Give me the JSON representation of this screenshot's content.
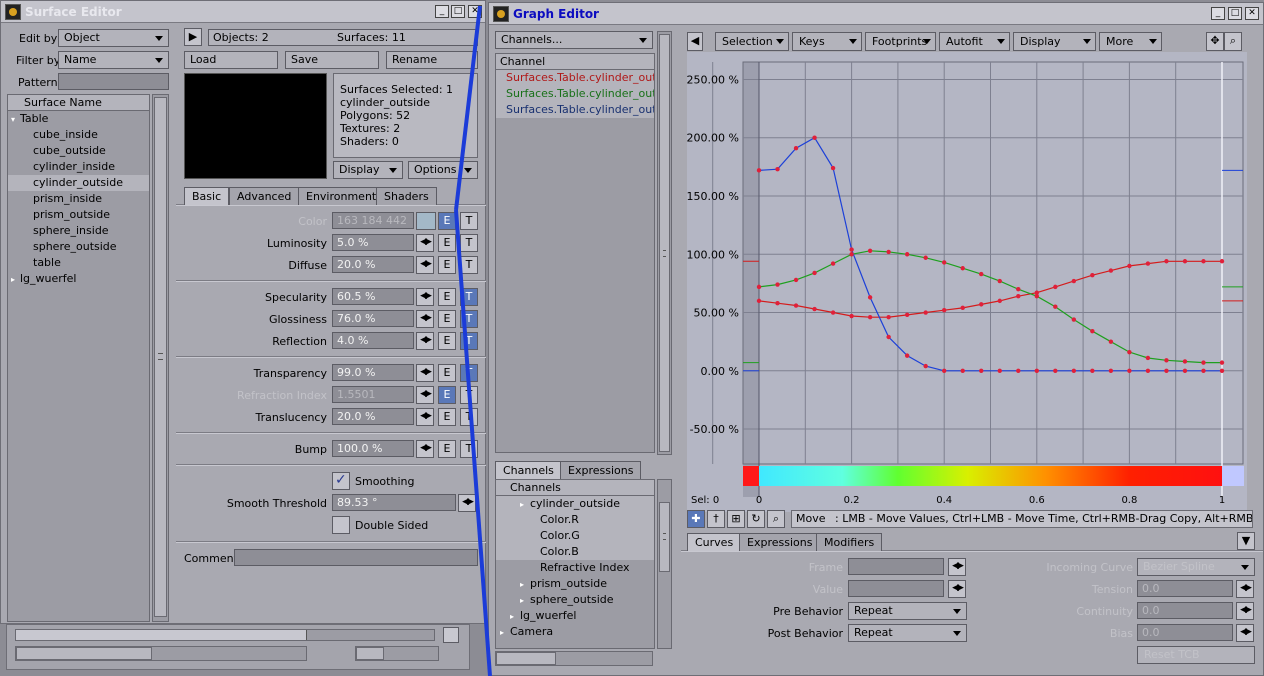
{
  "surface_editor": {
    "title": "Surface Editor",
    "edit_by_label": "Edit by",
    "edit_by_value": "Object",
    "filter_by_label": "Filter by",
    "filter_by_value": "Name",
    "pattern_label": "Pattern",
    "pattern_value": "",
    "list_header": "Surface Name",
    "tree": [
      {
        "label": "Table",
        "level": 0,
        "expanded": true,
        "selected": false
      },
      {
        "label": "cube_inside",
        "level": 1,
        "selected": false
      },
      {
        "label": "cube_outside",
        "level": 1,
        "selected": false
      },
      {
        "label": "cylinder_inside",
        "level": 1,
        "selected": false
      },
      {
        "label": "cylinder_outside",
        "level": 1,
        "selected": true
      },
      {
        "label": "prism_inside",
        "level": 1,
        "selected": false
      },
      {
        "label": "prism_outside",
        "level": 1,
        "selected": false
      },
      {
        "label": "sphere_inside",
        "level": 1,
        "selected": false
      },
      {
        "label": "sphere_outside",
        "level": 1,
        "selected": false
      },
      {
        "label": "table",
        "level": 1,
        "selected": false
      },
      {
        "label": "lg_wuerfel",
        "level": 0,
        "expanded": false,
        "selected": false
      }
    ],
    "objects_label": "Objects: 2",
    "surfaces_label": "Surfaces: 11",
    "load_label": "Load",
    "save_label": "Save",
    "rename_label": "Rename",
    "info": {
      "selected": "Surfaces Selected: 1",
      "name": "cylinder_outside",
      "polygons": "Polygons: 52",
      "textures": "Textures: 2",
      "shaders": "Shaders: 0"
    },
    "display_label": "Display",
    "options_label": "Options",
    "tabs": [
      {
        "label": "Basic",
        "active": true
      },
      {
        "label": "Advanced",
        "active": false
      },
      {
        "label": "Environment",
        "active": false
      },
      {
        "label": "Shaders",
        "active": false
      }
    ],
    "color": {
      "label": "Color",
      "value": "163  184  442",
      "swatch": "#a3b8c8"
    },
    "params": [
      {
        "label": "Luminosity",
        "value": "5.0 %",
        "disabled": false,
        "t_blue": false
      },
      {
        "label": "Diffuse",
        "value": "20.0 %",
        "disabled": false,
        "t_blue": false
      },
      {
        "label": "Specularity",
        "value": "60.5 %",
        "disabled": false,
        "t_blue": true
      },
      {
        "label": "Glossiness",
        "value": "76.0 %",
        "disabled": false,
        "t_blue": true
      },
      {
        "label": "Reflection",
        "value": "4.0 %",
        "disabled": false,
        "t_blue": true
      },
      {
        "label": "Transparency",
        "value": "99.0 %",
        "disabled": false,
        "t_blue": true
      },
      {
        "label": "Refraction Index",
        "value": "1.5501",
        "disabled": true,
        "e_blue": true,
        "t_blue": false
      },
      {
        "label": "Translucency",
        "value": "20.0 %",
        "disabled": false,
        "t_blue": false
      },
      {
        "label": "Bump",
        "value": "100.0 %",
        "disabled": false,
        "t_blue": false
      }
    ],
    "e_label": "E",
    "t_label": "T",
    "smoothing_label": "Smoothing",
    "smoothing_checked": true,
    "smooth_threshold_label": "Smooth Threshold",
    "smooth_threshold_value": "89.53 °",
    "double_sided_label": "Double Sided",
    "double_sided_checked": false,
    "comment_label": "Comment",
    "comment_value": ""
  },
  "graph_editor": {
    "title": "Graph Editor",
    "channels_dropdown": "Channels...",
    "channel_header": "Channel",
    "channel_list": [
      {
        "label": "Surfaces.Table.cylinder_out ...",
        "color": "#b01818"
      },
      {
        "label": "Surfaces.Table.cylinder_out ...",
        "color": "#187018"
      },
      {
        "label": "Surfaces.Table.cylinder_out ...",
        "color": "#183070"
      }
    ],
    "toolbar": [
      "Selection",
      "Keys",
      "Footprints",
      "Autofit",
      "Display",
      "More"
    ],
    "lower_tabs": [
      {
        "label": "Channels",
        "active": true
      },
      {
        "label": "Expressions",
        "active": false
      }
    ],
    "channels_tree_header": "Channels",
    "channels_tree": [
      {
        "label": "cylinder_outside",
        "level": 1,
        "selected": true,
        "expander": true
      },
      {
        "label": "Color.R",
        "level": 2,
        "selected": true,
        "expander": false
      },
      {
        "label": "Color.G",
        "level": 2,
        "selected": true,
        "expander": false
      },
      {
        "label": "Color.B",
        "level": 2,
        "selected": true,
        "expander": false
      },
      {
        "label": "Refractive Index",
        "level": 2,
        "selected": false,
        "expander": false
      },
      {
        "label": "prism_outside",
        "level": 1,
        "selected": false,
        "expander": true
      },
      {
        "label": "sphere_outside",
        "level": 1,
        "selected": false,
        "expander": true
      },
      {
        "label": "lg_wuerfel",
        "level": 0,
        "selected": false,
        "expander": true
      },
      {
        "label": "Camera",
        "level": -1,
        "selected": false,
        "expander": true
      }
    ],
    "sel_label": "Sel: 0",
    "status_mode": "Move",
    "status_text": ":  LMB - Move Values, Ctrl+LMB - Move Time, Ctrl+RMB-Drag Copy, Alt+RMB-Select C...",
    "curve_tabs": [
      {
        "label": "Curves",
        "active": true
      },
      {
        "label": "Expressions",
        "active": false
      },
      {
        "label": "Modifiers",
        "active": false
      }
    ],
    "frame_label": "Frame",
    "value_label": "Value",
    "pre_behavior_label": "Pre Behavior",
    "pre_behavior_value": "Repeat",
    "post_behavior_label": "Post Behavior",
    "post_behavior_value": "Repeat",
    "incoming_curve_label": "Incoming Curve",
    "incoming_curve_value": "Bezier Spline",
    "tension_label": "Tension",
    "tension_value": "0.0",
    "continuity_label": "Continuity",
    "continuity_value": "0.0",
    "bias_label": "Bias",
    "bias_value": "0.0",
    "reset_tcb_label": "Reset TCB"
  },
  "chart_data": {
    "type": "line",
    "title": "",
    "xlabel": "",
    "ylabel": "",
    "xlim": [
      -0.12,
      1.02
    ],
    "ylim": [
      -80,
      265
    ],
    "x_ticks": [
      0,
      0.2,
      0.4,
      0.6,
      0.8,
      1
    ],
    "x_tick_labels": [
      "0",
      "0.2",
      "0.4",
      "0.6",
      "0.8",
      "1"
    ],
    "y_ticks": [
      250,
      200,
      150,
      100,
      50,
      0,
      -50
    ],
    "y_tick_labels": [
      "250.00 %",
      "200.00 %",
      "150.00 %",
      "100.00 %",
      "50.00 %",
      "0.00 %",
      "-50.00 %"
    ],
    "grid": true,
    "series": [
      {
        "color": "#d41c1c",
        "x": [
          0,
          0.04,
          0.08,
          0.12,
          0.16,
          0.2,
          0.24,
          0.28,
          0.32,
          0.36,
          0.4,
          0.44,
          0.48,
          0.52,
          0.56,
          0.6,
          0.64,
          0.68,
          0.72,
          0.76,
          0.8,
          0.84,
          0.88,
          0.92,
          0.96,
          1
        ],
        "y": [
          60,
          58,
          56,
          53,
          50,
          47,
          46,
          46,
          48,
          50,
          52,
          54,
          57,
          60,
          64,
          67,
          72,
          77,
          82,
          86,
          90,
          92,
          94,
          94,
          94,
          94
        ]
      },
      {
        "color": "#1ea01e",
        "x": [
          0,
          0.04,
          0.08,
          0.12,
          0.16,
          0.2,
          0.24,
          0.28,
          0.32,
          0.36,
          0.4,
          0.44,
          0.48,
          0.52,
          0.56,
          0.6,
          0.64,
          0.68,
          0.72,
          0.76,
          0.8,
          0.84,
          0.88,
          0.92,
          0.96,
          1
        ],
        "y": [
          72,
          74,
          78,
          84,
          92,
          100,
          103,
          102,
          100,
          97,
          93,
          88,
          83,
          77,
          70,
          64,
          55,
          44,
          34,
          25,
          16,
          11,
          9,
          8,
          7,
          7
        ]
      },
      {
        "color": "#1c40d8",
        "x": [
          0,
          0.04,
          0.08,
          0.12,
          0.16,
          0.2,
          0.24,
          0.28,
          0.32,
          0.36,
          0.4,
          0.44,
          0.48,
          0.52,
          0.56,
          0.6,
          0.64,
          0.68,
          0.72,
          0.76,
          0.8,
          0.84,
          0.88,
          0.92,
          0.96,
          1
        ],
        "y": [
          172,
          173,
          191,
          200,
          174,
          104,
          63,
          29,
          13,
          4,
          0,
          0,
          0,
          0,
          0,
          0,
          0,
          0,
          0,
          0,
          0,
          0,
          0,
          0,
          0,
          0
        ]
      }
    ]
  },
  "colors": {
    "panel_bg": "#a9a9b1",
    "graph_bg": "#b4b6c4",
    "selection_blue": "#1c3cd8"
  }
}
